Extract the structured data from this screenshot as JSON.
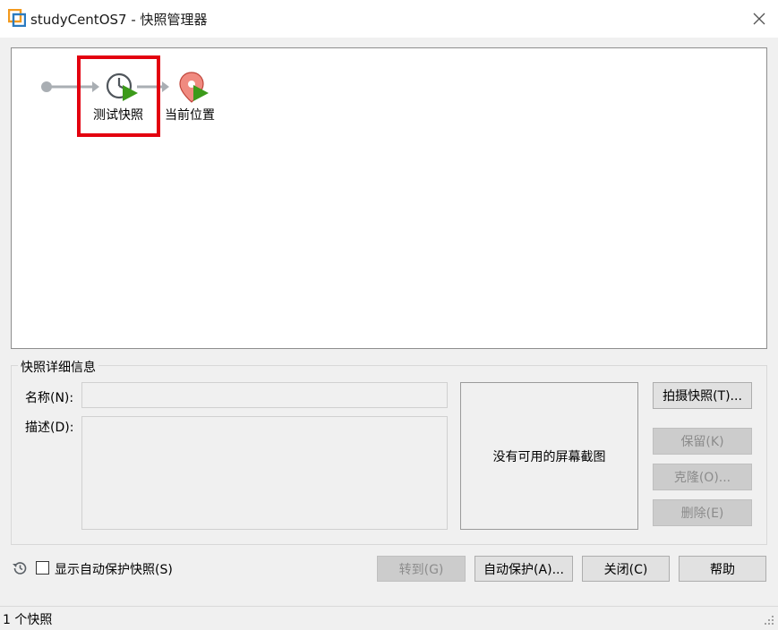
{
  "window": {
    "title": "studyCentOS7 - 快照管理器"
  },
  "tree": {
    "snapshot_label": "测试快照",
    "current_label": "当前位置"
  },
  "details": {
    "group_title": "快照详细信息",
    "name_label": "名称(N):",
    "name_value": "",
    "desc_label": "描述(D):",
    "desc_value": "",
    "no_screenshot": "没有可用的屏幕截图"
  },
  "actions": {
    "take_snapshot": "拍摄快照(T)...",
    "keep": "保留(K)",
    "clone": "克隆(O)...",
    "delete": "删除(E)"
  },
  "bottom": {
    "show_autoprotect": "显示自动保护快照(S)",
    "show_autoprotect_checked": false,
    "goto": "转到(G)",
    "autoprotect": "自动保护(A)...",
    "close": "关闭(C)",
    "help": "帮助"
  },
  "status": {
    "text": "1 个快照"
  },
  "colors": {
    "highlight": "#e3000f",
    "play_green": "#3c9a1a",
    "pin_pink": "#f08a80"
  }
}
